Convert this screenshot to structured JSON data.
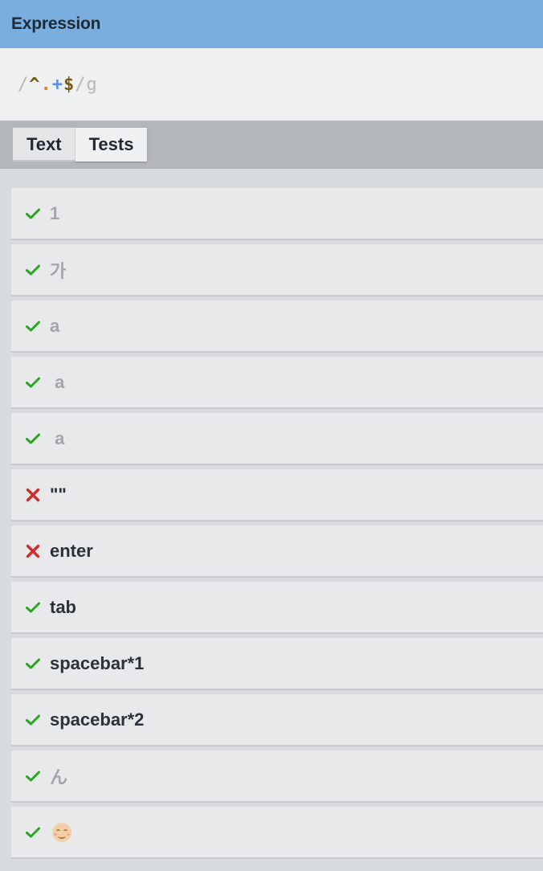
{
  "header": {
    "title": "Expression"
  },
  "expression": {
    "open_delim": "/",
    "anchor_start": "^",
    "dot": ".",
    "quantifier": "+",
    "anchor_end": "$",
    "close_delim": "/",
    "flags": "g"
  },
  "tabs": [
    {
      "label": "Text",
      "active": false
    },
    {
      "label": "Tests",
      "active": true
    }
  ],
  "tests": [
    {
      "text": "1",
      "status": "pass",
      "icon": "check-icon",
      "style": "light"
    },
    {
      "text": "가",
      "status": "pass",
      "icon": "check-icon",
      "style": "light"
    },
    {
      "text": "a",
      "status": "pass",
      "icon": "check-icon",
      "style": "light"
    },
    {
      "text": " a",
      "status": "pass",
      "icon": "check-icon",
      "style": "light"
    },
    {
      "text": " a",
      "status": "pass",
      "icon": "check-icon",
      "style": "light"
    },
    {
      "text": "\"\"",
      "status": "fail",
      "icon": "cross-icon",
      "style": "dark"
    },
    {
      "text": "enter",
      "status": "fail",
      "icon": "cross-icon",
      "style": "dark"
    },
    {
      "text": "tab",
      "status": "pass",
      "icon": "check-icon",
      "style": "dark"
    },
    {
      "text": "spacebar*1",
      "status": "pass",
      "icon": "check-icon",
      "style": "dark"
    },
    {
      "text": "spacebar*2",
      "status": "pass",
      "icon": "check-icon",
      "style": "dark"
    },
    {
      "text": "ん",
      "status": "pass",
      "icon": "check-icon",
      "style": "light"
    },
    {
      "text": "",
      "status": "pass",
      "icon": "check-icon",
      "style": "light",
      "emoji": "smiling-face-icon"
    }
  ],
  "colors": {
    "header_bg": "#7aaede",
    "pass": "#2aa520",
    "fail": "#d62a2a"
  }
}
